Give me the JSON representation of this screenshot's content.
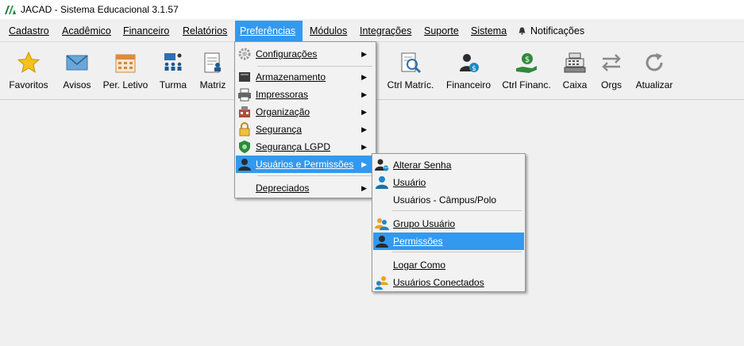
{
  "window": {
    "title": "JACAD - Sistema Educacional 3.1.57"
  },
  "menubar": {
    "cadastro": "Cadastro",
    "academico": "Acadêmico",
    "financeiro": "Financeiro",
    "relatorios": "Relatórios",
    "preferencias": "Preferências",
    "modulos": "Módulos",
    "integracoes": "Integrações",
    "suporte": "Suporte",
    "sistema": "Sistema",
    "notificacoes": "Notificações"
  },
  "toolbar": {
    "favoritos": "Favoritos",
    "avisos": "Avisos",
    "per_letivo": "Per. Letivo",
    "turma": "Turma",
    "matriz": "Matriz",
    "ctrl_matric": "Ctrl Matríc.",
    "financeiro": "Financeiro",
    "ctrl_financ": "Ctrl Financ.",
    "caixa": "Caixa",
    "orgs": "Orgs",
    "atualizar": "Atualizar"
  },
  "preferencias_menu": {
    "configuracoes": "Configurações",
    "armazenamento": "Armazenamento",
    "impressoras": "Impressoras",
    "organizacao": "Organização",
    "seguranca": "Segurança",
    "seguranca_lgpd": "Segurança LGPD",
    "usuarios_permissoes": "Usuários e Permissões",
    "depreciados": "Depreciados"
  },
  "usuarios_submenu": {
    "alterar_senha": "Alterar Senha",
    "usuario": "Usuário",
    "usuarios_campus": "Usuários - Câmpus/Polo",
    "grupo_usuario": "Grupo Usuário",
    "permissoes": "Permissões",
    "logar_como": "Logar Como",
    "usuarios_conectados": "Usuários Conectados"
  },
  "colors": {
    "highlight": "#3399ee",
    "accent_blue": "#1e88c8",
    "accent_green": "#2e8b3a"
  }
}
